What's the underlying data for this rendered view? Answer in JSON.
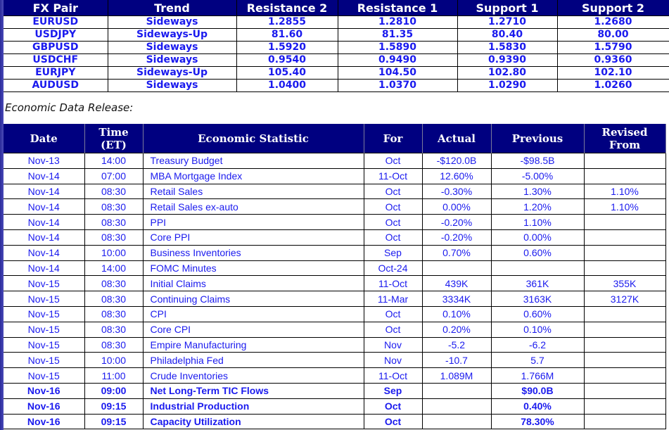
{
  "fx_table": {
    "headers": [
      "FX Pair",
      "Trend",
      "Resistance 2",
      "Resistance 1",
      "Support 1",
      "Support 2"
    ],
    "rows": [
      [
        "EURUSD",
        "Sideways",
        "1.2855",
        "1.2810",
        "1.2710",
        "1.2680"
      ],
      [
        "USDJPY",
        "Sideways-Up",
        "81.60",
        "81.35",
        "80.40",
        "80.00"
      ],
      [
        "GBPUSD",
        "Sideways",
        "1.5920",
        "1.5890",
        "1.5830",
        "1.5790"
      ],
      [
        "USDCHF",
        "Sideways",
        "0.9540",
        "0.9490",
        "0.9390",
        "0.9360"
      ],
      [
        "EURJPY",
        "Sideways-Up",
        "105.40",
        "104.50",
        "102.80",
        "102.10"
      ],
      [
        "AUDUSD",
        "Sideways",
        "1.0400",
        "1.0370",
        "1.0290",
        "1.0260"
      ]
    ]
  },
  "caption": "Economic Data Release:",
  "econ_table": {
    "headers": [
      "Date",
      "Time (ET)",
      "Economic Statistic",
      "For",
      "Actual",
      "Previous",
      "Revised From"
    ],
    "header_lines": {
      "time": [
        "Time",
        "(ET)"
      ],
      "revised": [
        "Revised",
        "From"
      ]
    },
    "rows": [
      {
        "date": "Nov-13",
        "time": "14:00",
        "stat": "Treasury Budget",
        "for": "Oct",
        "actual": "-$120.0B",
        "previous": "-$98.5B",
        "revised": "",
        "bold": false
      },
      {
        "date": "Nov-14",
        "time": "07:00",
        "stat": "MBA Mortgage Index",
        "for": "11-Oct",
        "actual": "12.60%",
        "previous": "-5.00%",
        "revised": "",
        "bold": false
      },
      {
        "date": "Nov-14",
        "time": "08:30",
        "stat": "Retail Sales",
        "for": "Oct",
        "actual": "-0.30%",
        "previous": "1.30%",
        "revised": "1.10%",
        "bold": false
      },
      {
        "date": "Nov-14",
        "time": "08:30",
        "stat": "Retail Sales ex-auto",
        "for": "Oct",
        "actual": "0.00%",
        "previous": "1.20%",
        "revised": "1.10%",
        "bold": false
      },
      {
        "date": "Nov-14",
        "time": "08:30",
        "stat": "PPI",
        "for": "Oct",
        "actual": "-0.20%",
        "previous": "1.10%",
        "revised": "",
        "bold": false
      },
      {
        "date": "Nov-14",
        "time": "08:30",
        "stat": "Core PPI",
        "for": "Oct",
        "actual": "-0.20%",
        "previous": "0.00%",
        "revised": "",
        "bold": false
      },
      {
        "date": "Nov-14",
        "time": "10:00",
        "stat": "Business Inventories",
        "for": "Sep",
        "actual": "0.70%",
        "previous": "0.60%",
        "revised": "",
        "bold": false
      },
      {
        "date": "Nov-14",
        "time": "14:00",
        "stat": "FOMC Minutes",
        "for": "Oct-24",
        "actual": "",
        "previous": "",
        "revised": "",
        "bold": false
      },
      {
        "date": "Nov-15",
        "time": "08:30",
        "stat": "Initial Claims",
        "for": "11-Oct",
        "actual": "439K",
        "previous": "361K",
        "revised": "355K",
        "bold": false
      },
      {
        "date": "Nov-15",
        "time": "08:30",
        "stat": "Continuing Claims",
        "for": "11-Mar",
        "actual": "3334K",
        "previous": "3163K",
        "revised": "3127K",
        "bold": false
      },
      {
        "date": "Nov-15",
        "time": "08:30",
        "stat": "CPI",
        "for": "Oct",
        "actual": "0.10%",
        "previous": "0.60%",
        "revised": "",
        "bold": false
      },
      {
        "date": "Nov-15",
        "time": "08:30",
        "stat": "Core CPI",
        "for": "Oct",
        "actual": "0.20%",
        "previous": "0.10%",
        "revised": "",
        "bold": false
      },
      {
        "date": "Nov-15",
        "time": "08:30",
        "stat": "Empire Manufacturing",
        "for": "Nov",
        "actual": "-5.2",
        "previous": "-6.2",
        "revised": "",
        "bold": false
      },
      {
        "date": "Nov-15",
        "time": "10:00",
        "stat": "Philadelphia Fed",
        "for": "Nov",
        "actual": "-10.7",
        "previous": "5.7",
        "revised": "",
        "bold": false
      },
      {
        "date": "Nov-15",
        "time": "11:00",
        "stat": "Crude Inventories",
        "for": "11-Oct",
        "actual": "1.089M",
        "previous": "1.766M",
        "revised": "",
        "bold": false
      },
      {
        "date": "Nov-16",
        "time": "09:00",
        "stat": "Net Long-Term TIC Flows",
        "for": "Sep",
        "actual": "",
        "previous": "$90.0B",
        "revised": "",
        "bold": true
      },
      {
        "date": "Nov-16",
        "time": "09:15",
        "stat": "Industrial Production",
        "for": "Oct",
        "actual": "",
        "previous": "0.40%",
        "revised": "",
        "bold": true
      },
      {
        "date": "Nov-16",
        "time": "09:15",
        "stat": "Capacity Utilization",
        "for": "Oct",
        "actual": "",
        "previous": "78.30%",
        "revised": "",
        "bold": true
      }
    ]
  },
  "colors": {
    "header_bg": "#000080",
    "header_text": "#ffffff",
    "cell_text": "#1a1aee"
  }
}
